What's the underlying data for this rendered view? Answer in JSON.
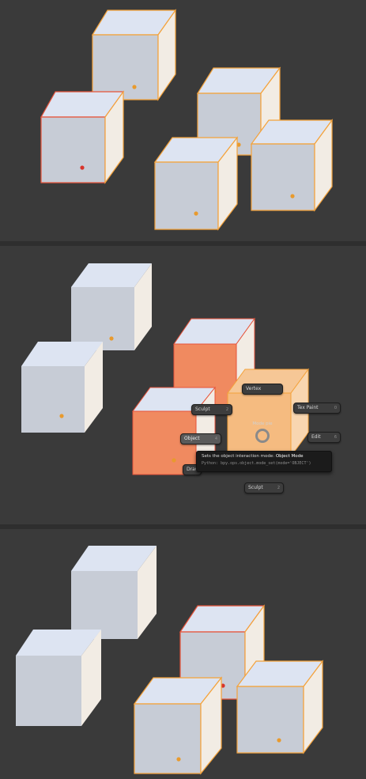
{
  "colors": {
    "background": "#3a3a3a",
    "cube_top": "#dde4f2",
    "cube_front": "#c7ccd6",
    "cube_side": "#f2ece4",
    "selected_outline": "#f4a23a",
    "active_outline": "#e6533a",
    "highlight_fill": "#f08a60",
    "origin_dot": "#e89a2e"
  },
  "pie_menu": {
    "center_label": "Mode pie",
    "items": [
      {
        "id": "vertex",
        "label": "Vertex",
        "key": ""
      },
      {
        "id": "sculpt-left",
        "label": "Sculpt",
        "key": "2"
      },
      {
        "id": "tex-paint",
        "label": "Tex Paint",
        "key": "0"
      },
      {
        "id": "object",
        "label": "Object",
        "key": "4"
      },
      {
        "id": "edit",
        "label": "Edit",
        "key": "6"
      },
      {
        "id": "draw",
        "label": "Draw",
        "key": ""
      },
      {
        "id": "sculpt-bottom",
        "label": "Sculpt",
        "key": "2"
      }
    ]
  },
  "tooltip": {
    "description": "Sets the object interaction mode:",
    "mode": "Object Mode",
    "python": "Python: bpy.ops.object.mode_set(mode='OBJECT')"
  }
}
